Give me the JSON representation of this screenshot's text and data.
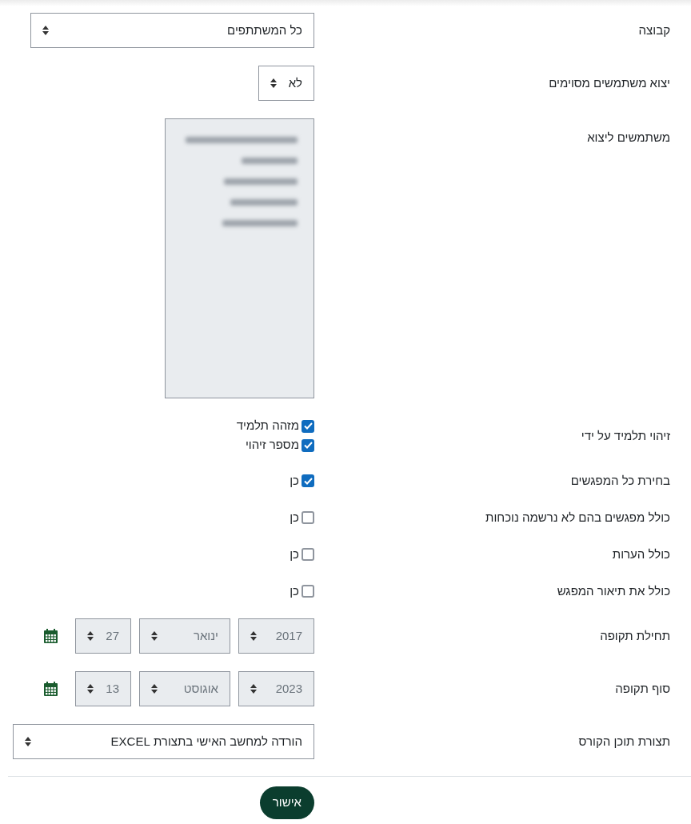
{
  "fields": [
    {
      "kind": "select",
      "label": "קבוצה",
      "value": "כל המשתתפים"
    },
    {
      "kind": "compact_select",
      "label": "יצוא משתמשים מסוימים",
      "value": "לא"
    },
    {
      "kind": "listbox",
      "label": "משתמשים ליצוא",
      "disabled": true
    },
    {
      "kind": "checkboxes",
      "label": "זיהוי תלמיד על ידי",
      "options": [
        {
          "label": "מזהה תלמיד",
          "checked": true
        },
        {
          "label": "מספר זיהוי",
          "checked": true
        }
      ]
    },
    {
      "kind": "checkboxes",
      "label": "בחירת כל המפגשים",
      "options": [
        {
          "label": "כן",
          "checked": true
        }
      ]
    },
    {
      "kind": "checkboxes",
      "label": "כולל מפגשים בהם לא נרשמה נוכחות",
      "options": [
        {
          "label": "כן",
          "checked": false
        }
      ]
    },
    {
      "kind": "checkboxes",
      "label": "כולל הערות",
      "options": [
        {
          "label": "כן",
          "checked": false
        }
      ]
    },
    {
      "kind": "checkboxes",
      "label": "כולל את תיאור המפגש",
      "options": [
        {
          "label": "כן",
          "checked": false
        }
      ]
    },
    {
      "kind": "date",
      "label": "תחילת תקופה",
      "disabled": true,
      "parts": [
        "2017",
        "ינואר",
        "27"
      ]
    },
    {
      "kind": "date",
      "label": "סוף תקופה",
      "disabled": true,
      "parts": [
        "2023",
        "אוגוסט",
        "13"
      ]
    },
    {
      "kind": "wide_select",
      "label": "תצורת תוכן הקורס",
      "value": "הורדה למחשב האישי בתצורת EXCEL"
    }
  ],
  "submit": {
    "label": "אישור"
  }
}
